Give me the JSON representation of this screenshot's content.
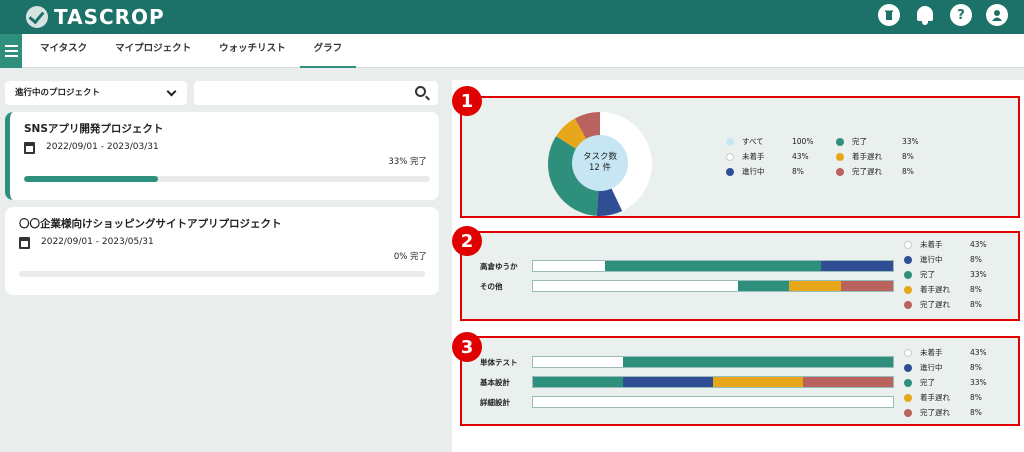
{
  "header": {
    "logo_text": "TASCROP",
    "icons": [
      "trash-icon",
      "bell-icon",
      "help-icon",
      "user-icon"
    ],
    "help_glyph": "?"
  },
  "nav": {
    "tabs": [
      {
        "label": "マイタスク"
      },
      {
        "label": "マイプロジェクト"
      },
      {
        "label": "ウォッチリスト"
      },
      {
        "label": "グラフ",
        "active": true
      }
    ]
  },
  "filter": {
    "label": "進行中のプロジェクト"
  },
  "search": {
    "placeholder": ""
  },
  "projects": [
    {
      "name": "SNSアプリ開発プロジェクト",
      "dates": "2022/09/01 - 2023/03/31",
      "percent_label": "33% 完了",
      "progress": 0.33
    },
    {
      "name": "〇〇企業様向けショッピングサイトアプリプロジェクト",
      "dates": "2022/09/01 - 2023/05/31",
      "percent_label": "0% 完了",
      "progress": 0
    }
  ],
  "colors": {
    "not_started": "#ffffff",
    "in_progress": "#2f4e94",
    "done": "#2e8f7d",
    "late_start": "#e6a71a",
    "late_finish": "#b9625e",
    "all": "#c5e6f2",
    "highlight": "#e00000"
  },
  "box1": {
    "badge": "1",
    "pie_center": "タスク数\n12 件",
    "pie_center_line1": "タスク数",
    "pie_center_line2": "12 件",
    "legend": [
      {
        "label": "すべて",
        "pct": "100%",
        "key": "all"
      },
      {
        "label": "未着手",
        "pct": "43%",
        "key": "not_started"
      },
      {
        "label": "進行中",
        "pct": "8%",
        "key": "in_progress"
      },
      {
        "label": "完了",
        "pct": "33%",
        "key": "done"
      },
      {
        "label": "着手遅れ",
        "pct": "8%",
        "key": "late_start"
      },
      {
        "label": "完了遅れ",
        "pct": "8%",
        "key": "late_finish"
      }
    ]
  },
  "box2": {
    "badge": "2",
    "rows": [
      {
        "label": "高倉ゆうか",
        "segments": [
          {
            "key": "not_started",
            "v": 0.2
          },
          {
            "key": "done",
            "v": 0.6
          },
          {
            "key": "in_progress",
            "v": 0.2
          }
        ]
      },
      {
        "label": "その他",
        "segments": [
          {
            "key": "not_started",
            "v": 0.57
          },
          {
            "key": "done",
            "v": 0.14
          },
          {
            "key": "late_start",
            "v": 0.145
          },
          {
            "key": "late_finish",
            "v": 0.145
          }
        ]
      }
    ],
    "legend": [
      {
        "label": "未着手",
        "pct": "43%",
        "key": "not_started"
      },
      {
        "label": "進行中",
        "pct": "8%",
        "key": "in_progress"
      },
      {
        "label": "完了",
        "pct": "33%",
        "key": "done"
      },
      {
        "label": "着手遅れ",
        "pct": "8%",
        "key": "late_start"
      },
      {
        "label": "完了遅れ",
        "pct": "8%",
        "key": "late_finish"
      }
    ]
  },
  "box3": {
    "badge": "3",
    "rows": [
      {
        "label": "単体テスト",
        "segments": [
          {
            "key": "not_started",
            "v": 0.25
          },
          {
            "key": "done",
            "v": 0.75
          }
        ]
      },
      {
        "label": "基本設計",
        "segments": [
          {
            "key": "done",
            "v": 0.25
          },
          {
            "key": "in_progress",
            "v": 0.25
          },
          {
            "key": "late_start",
            "v": 0.25
          },
          {
            "key": "late_finish",
            "v": 0.25
          }
        ]
      },
      {
        "label": "詳細設計",
        "segments": [
          {
            "key": "not_started",
            "v": 1.0
          }
        ]
      }
    ],
    "legend": [
      {
        "label": "未着手",
        "pct": "43%",
        "key": "not_started"
      },
      {
        "label": "進行中",
        "pct": "8%",
        "key": "in_progress"
      },
      {
        "label": "完了",
        "pct": "33%",
        "key": "done"
      },
      {
        "label": "着手遅れ",
        "pct": "8%",
        "key": "late_start"
      },
      {
        "label": "完了遅れ",
        "pct": "8%",
        "key": "late_finish"
      }
    ]
  },
  "chart_data": [
    {
      "type": "pie",
      "categories": [
        "未着手",
        "進行中",
        "完了",
        "着手遅れ",
        "完了遅れ"
      ],
      "values": [
        43,
        8,
        33,
        8,
        8
      ],
      "title": ""
    },
    {
      "type": "bar",
      "categories": [
        "高倉ゆうか",
        "その他"
      ],
      "series": [
        {
          "name": "未着手",
          "values": [
            20,
            57
          ]
        },
        {
          "name": "進行中",
          "values": [
            20,
            0
          ]
        },
        {
          "name": "完了",
          "values": [
            60,
            14
          ]
        },
        {
          "name": "着手遅れ",
          "values": [
            0,
            14.5
          ]
        },
        {
          "name": "完了遅れ",
          "values": [
            0,
            14.5
          ]
        }
      ]
    },
    {
      "type": "bar",
      "categories": [
        "単体テスト",
        "基本設計",
        "詳細設計"
      ],
      "series": [
        {
          "name": "未着手",
          "values": [
            25,
            0,
            100
          ]
        },
        {
          "name": "進行中",
          "values": [
            0,
            25,
            0
          ]
        },
        {
          "name": "完了",
          "values": [
            75,
            25,
            0
          ]
        },
        {
          "name": "着手遅れ",
          "values": [
            0,
            25,
            0
          ]
        },
        {
          "name": "完了遅れ",
          "values": [
            0,
            25,
            0
          ]
        }
      ]
    }
  ]
}
